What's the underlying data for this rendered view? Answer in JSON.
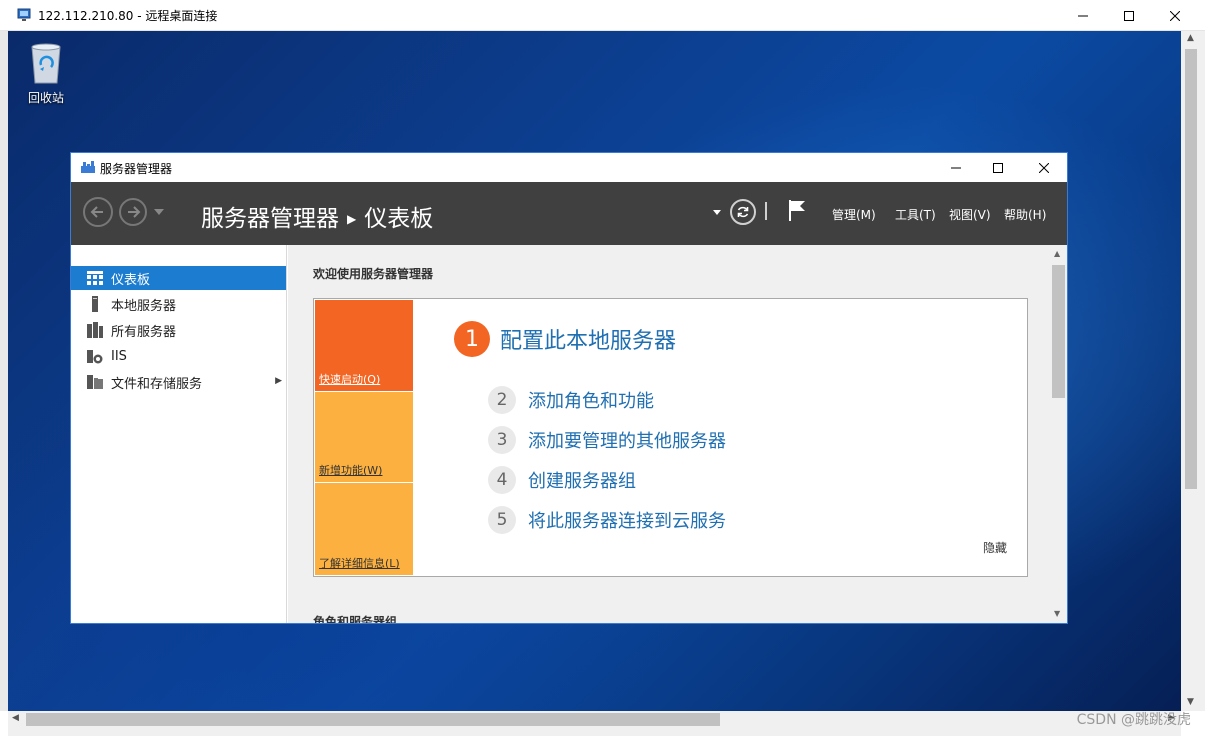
{
  "rdp": {
    "title": "122.112.210.80 - 远程桌面连接",
    "icon": "remote-desktop-icon"
  },
  "desktop": {
    "recycle_bin_label": "回收站"
  },
  "server_manager": {
    "window_title": "服务器管理器",
    "breadcrumb": {
      "root": "服务器管理器",
      "current": "仪表板"
    },
    "menus": [
      {
        "label": "管理(M)"
      },
      {
        "label": "工具(T)"
      },
      {
        "label": "视图(V)"
      },
      {
        "label": "帮助(H)"
      }
    ],
    "sidebar": [
      {
        "label": "仪表板",
        "icon": "dashboard-icon",
        "active": true
      },
      {
        "label": "本地服务器",
        "icon": "server-icon",
        "active": false
      },
      {
        "label": "所有服务器",
        "icon": "servers-icon",
        "active": false
      },
      {
        "label": "IIS",
        "icon": "iis-icon",
        "active": false
      },
      {
        "label": "文件和存储服务",
        "icon": "storage-icon",
        "active": false
      }
    ],
    "main": {
      "welcome_title": "欢迎使用服务器管理器",
      "tiles": {
        "quick_start": "快速启动(Q)",
        "whats_new": "新增功能(W)",
        "learn_more": "了解详细信息(L)"
      },
      "steps": [
        {
          "num": "1",
          "label": "配置此本地服务器"
        },
        {
          "num": "2",
          "label": "添加角色和功能"
        },
        {
          "num": "3",
          "label": "添加要管理的其他服务器"
        },
        {
          "num": "4",
          "label": "创建服务器组"
        },
        {
          "num": "5",
          "label": "将此服务器连接到云服务"
        }
      ],
      "hide_label": "隐藏",
      "roles_title": "角色和服务器组"
    }
  },
  "watermark": "CSDN @跳跳没虎",
  "colors": {
    "accent_orange": "#f26522",
    "tile_yellow": "#fbb040",
    "link_blue": "#1f6fb2",
    "active_blue": "#1c7ccf",
    "header_dark": "#404040"
  }
}
